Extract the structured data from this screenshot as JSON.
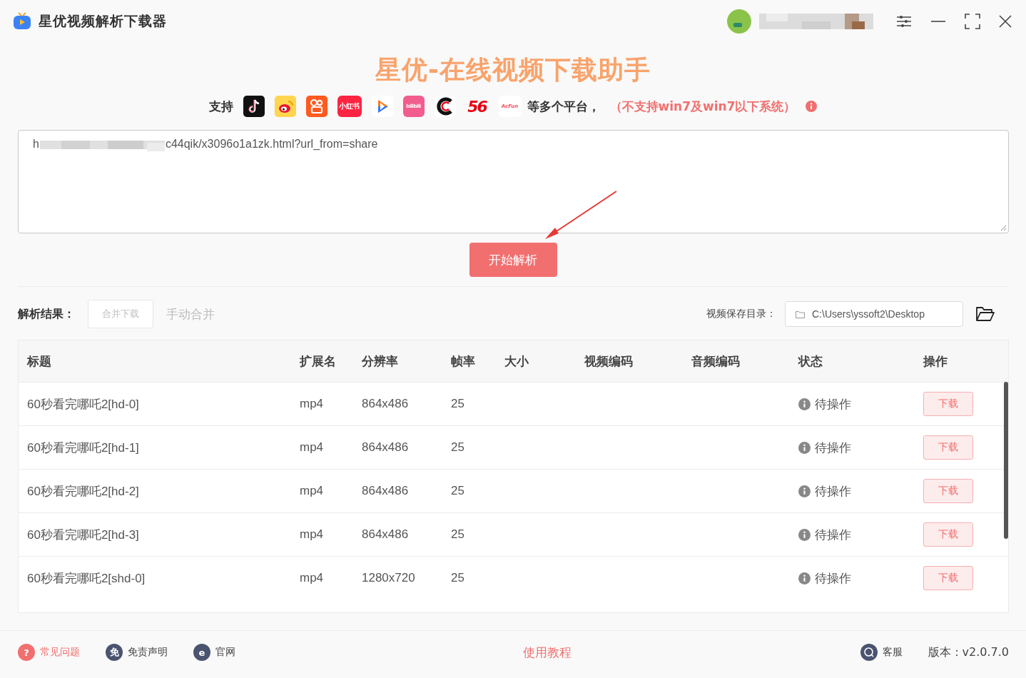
{
  "window": {
    "title": "星优视频解析下载器"
  },
  "hero": {
    "title": "星优-在线视频下载助手",
    "support_label": "支持",
    "platforms": [
      {
        "kind": "tiktok"
      },
      {
        "kind": "weibo"
      },
      {
        "kind": "kuaishou"
      },
      {
        "kind": "xiaohongshu",
        "label": "小红书"
      },
      {
        "kind": "tencent"
      },
      {
        "kind": "bilibili",
        "label": "bilibili"
      },
      {
        "kind": "ccc"
      },
      {
        "kind": "five-six",
        "label": "56"
      },
      {
        "kind": "acfun",
        "label": "AcFun"
      }
    ],
    "more_label": "等多个平台，",
    "warning": "（不支持win7及win7以下系统）"
  },
  "url_input": {
    "value_start": "h",
    "value_end": "c44qik/x3096o1a1zk.html?url_from=share"
  },
  "parse_button": "开始解析",
  "results": {
    "label": "解析结果：",
    "merge_download": {
      "label": "合并下载",
      "disabled": true
    },
    "manual_merge": {
      "label": "手动合并",
      "disabled": true
    },
    "save_dir_label": "视频保存目录：",
    "save_dir": "C:\\Users\\yssoft2\\Desktop"
  },
  "table": {
    "columns": [
      "标题",
      "扩展名",
      "分辨率",
      "帧率",
      "大小",
      "视频编码",
      "音频编码",
      "状态",
      "操作"
    ],
    "rows": [
      {
        "title": "60秒看完哪吒2[hd-0]",
        "ext": "mp4",
        "resolution": "864x486",
        "fps": "25",
        "status": "待操作",
        "action": "下载"
      },
      {
        "title": "60秒看完哪吒2[hd-1]",
        "ext": "mp4",
        "resolution": "864x486",
        "fps": "25",
        "status": "待操作",
        "action": "下载"
      },
      {
        "title": "60秒看完哪吒2[hd-2]",
        "ext": "mp4",
        "resolution": "864x486",
        "fps": "25",
        "status": "待操作",
        "action": "下载"
      },
      {
        "title": "60秒看完哪吒2[hd-3]",
        "ext": "mp4",
        "resolution": "864x486",
        "fps": "25",
        "status": "待操作",
        "action": "下载"
      },
      {
        "title": "60秒看完哪吒2[shd-0]",
        "ext": "mp4",
        "resolution": "1280x720",
        "fps": "25",
        "status": "待操作",
        "action": "下载"
      }
    ]
  },
  "footer": {
    "links": [
      {
        "kind": "faq",
        "icon_text": "?",
        "label": "常见问题"
      },
      {
        "kind": "disclaimer",
        "icon_text": "免",
        "label": "免责声明"
      },
      {
        "kind": "website",
        "icon_text": "e",
        "label": "官网"
      }
    ],
    "tutorial": "使用教程",
    "support": "客服",
    "version": "版本：v2.0.7.0"
  }
}
